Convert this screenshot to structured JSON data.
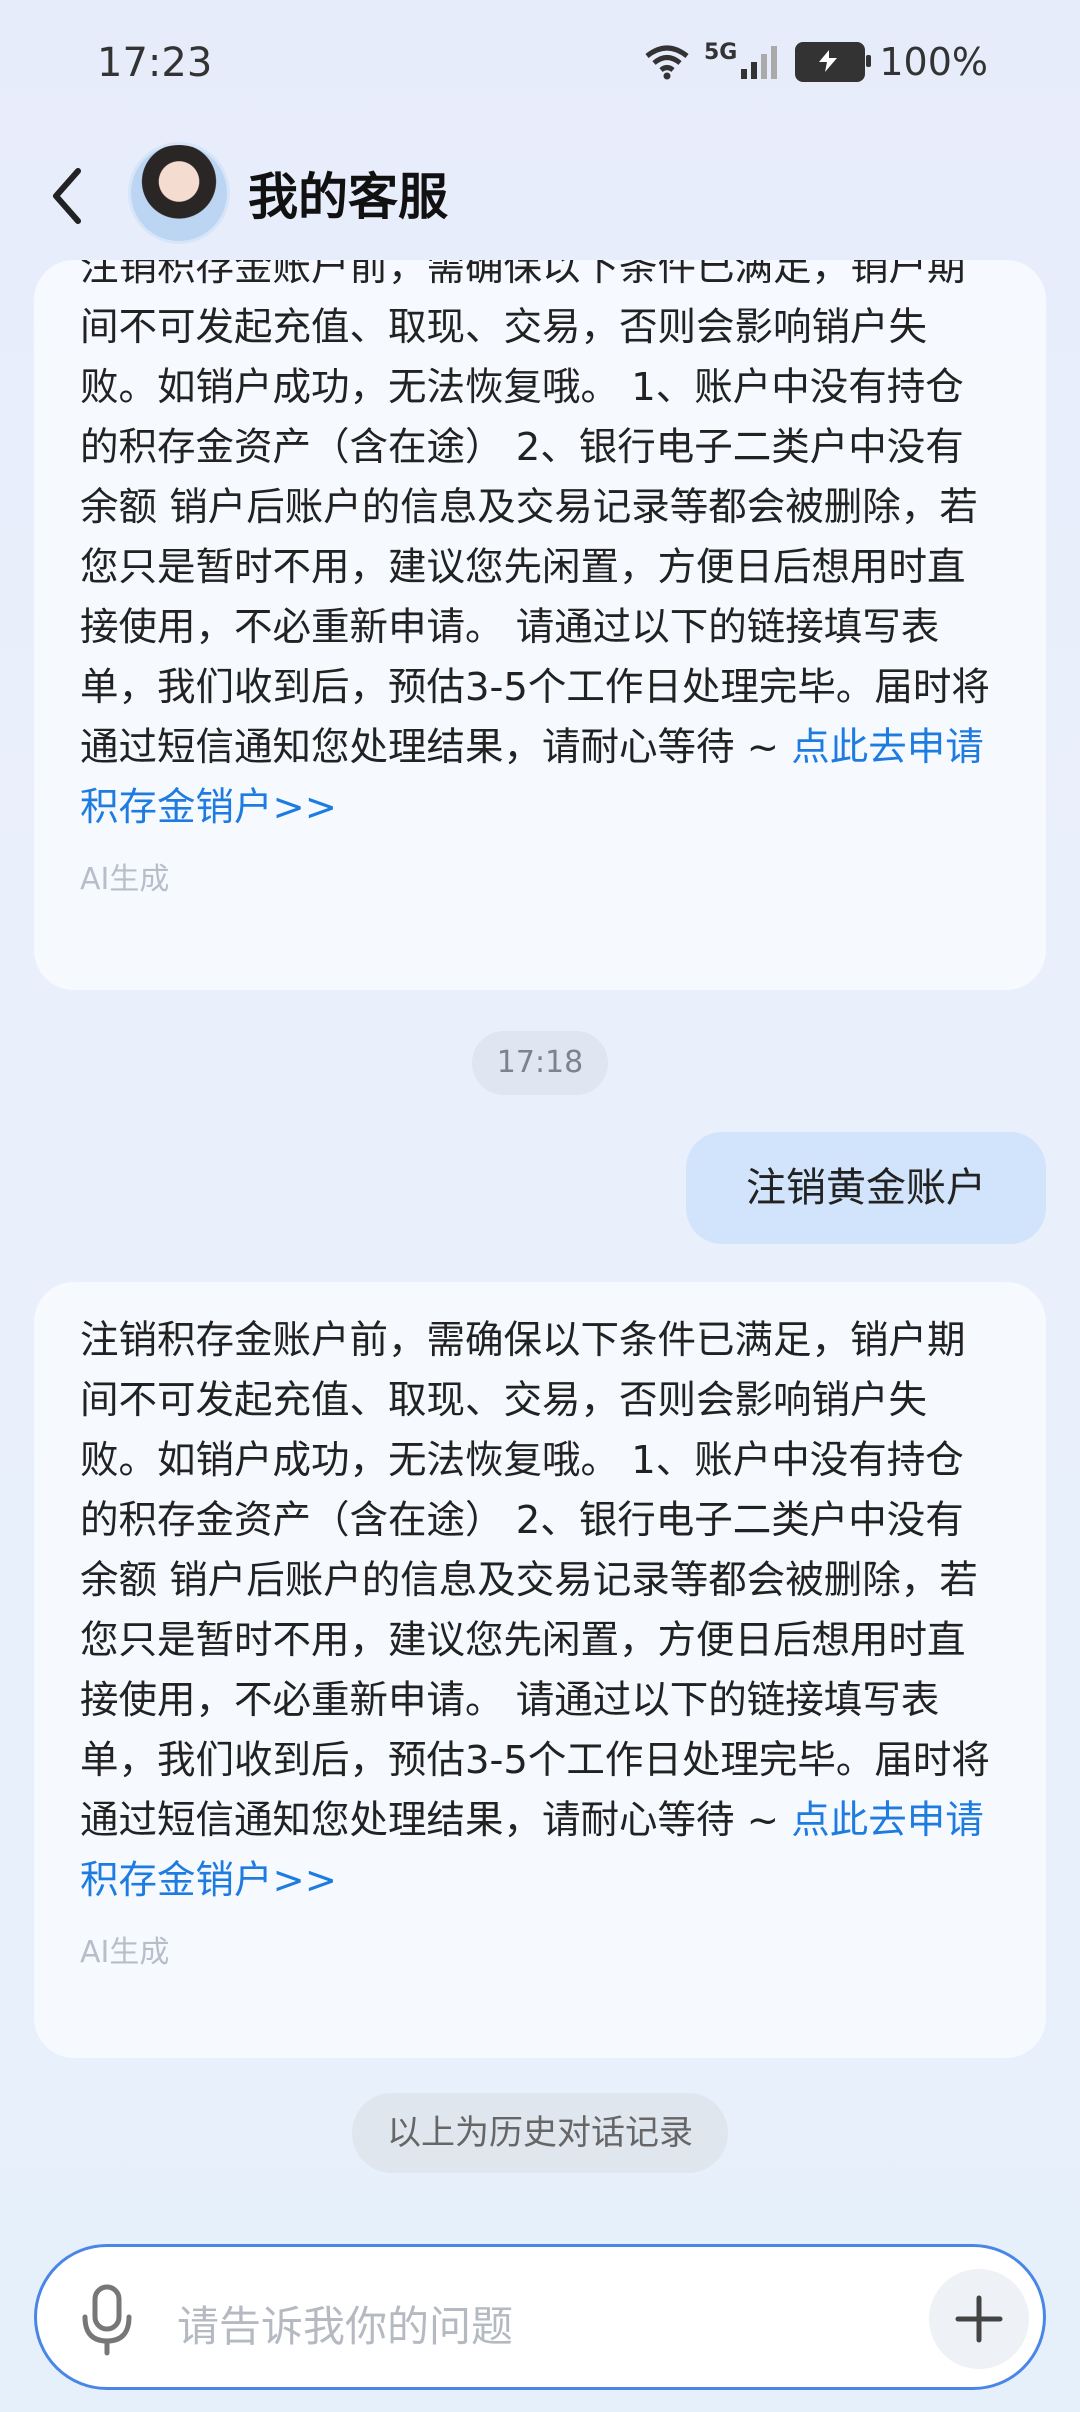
{
  "status": {
    "time": "17:23",
    "network": "5G",
    "battery": "100%"
  },
  "header": {
    "title": "我的客服"
  },
  "messages": [
    {
      "text": "注销积存金账户前，需确保以下条件已满足，销户期间不可发起充值、取现、交易，否则会影响销户失败。如销户成功，无法恢复哦。 1、账户中没有持仓的积存金资产（含在途） 2、银行电子二类户中没有余额 销户后账户的信息及交易记录等都会被删除，若您只是暂时不用，建议您先闲置，方便日后想用时直接使用，不必重新申请。 请通过以下的链接填写表单，我们收到后，预估3-5个工作日处理完毕。届时将通过短信通知您处理结果，请耐心等待 ~ ",
      "link": "点此去申请积存金销户>>",
      "tag": "AI生成"
    },
    {
      "time": "17:18"
    },
    {
      "user_text": "注销黄金账户"
    },
    {
      "text": "注销积存金账户前，需确保以下条件已满足，销户期间不可发起充值、取现、交易，否则会影响销户失败。如销户成功，无法恢复哦。 1、账户中没有持仓的积存金资产（含在途） 2、银行电子二类户中没有余额 销户后账户的信息及交易记录等都会被删除，若您只是暂时不用，建议您先闲置，方便日后想用时直接使用，不必重新申请。 请通过以下的链接填写表单，我们收到后，预估3-5个工作日处理完毕。届时将通过短信通知您处理结果，请耐心等待 ~ ",
      "link": "点此去申请积存金销户>>",
      "tag": "AI生成"
    },
    {
      "notice": "以上为历史对话记录"
    }
  ],
  "input": {
    "placeholder": "请告诉我你的问题"
  },
  "colors": {
    "accent": "#1e7be0",
    "user_bubble": "#d1e4fb",
    "input_border": "#4a86e8"
  }
}
